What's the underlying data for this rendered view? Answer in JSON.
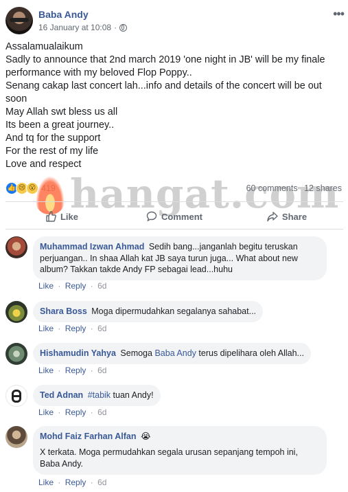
{
  "post": {
    "author": "Baba Andy",
    "timestamp": "16 January at 10:08",
    "separator": "·",
    "more_icon": "•••",
    "lines": [
      "Assalamualaikum",
      "Sadly to announce that 2nd march 2019 'one night in JB' will be my finale",
      "performance with my beloved Flop Poppy..",
      "Senang cakap last concert lah...info and details of the concert will be out",
      "soon",
      "May Allah swt bless us all",
      "Its been a great journey..",
      "And tq for the support",
      "For the rest of my life",
      "Love and respect"
    ]
  },
  "reactions": {
    "icons": [
      "like-icon",
      "sad-icon",
      "wow-icon"
    ],
    "count": "419",
    "comments": "60 comments",
    "shares": "12 shares"
  },
  "watermark": {
    "text": "hangat.com"
  },
  "actions": {
    "like": "Like",
    "comment": "Comment",
    "share": "Share"
  },
  "comment_actions": {
    "like": "Like",
    "reply": "Reply",
    "sep": "·"
  },
  "comments": [
    {
      "name": "Muhammad Izwan Ahmad",
      "lines": [
        "Sedih bang...janganlah begitu teruskan",
        "perjuangan.. In shaa Allah kat JB saya turun juga... What about new",
        "album? Takkan takde Andy FP sebagai lead...huhu"
      ],
      "time": "6d"
    },
    {
      "name": "Shara Boss",
      "text": "Moga dipermudahkan segalanya sahabat...",
      "time": "6d"
    },
    {
      "name": "Hishamudin Yahya",
      "text_before": "Semoga",
      "link": "Baba Andy",
      "text_after": "terus dipelihara oleh Allah...",
      "time": "6d"
    },
    {
      "name": "Ted Adnan",
      "hashtag": "#tabik",
      "text_after": "tuan Andy!",
      "time": "6d"
    },
    {
      "name": "Mohd Faiz Farhan Alfan",
      "emoji": "😭",
      "lines": [
        "X terkata. Moga permudahkan segala urusan sepanjang tempoh ini,",
        "Baba Andy."
      ],
      "time": "6d"
    }
  ],
  "colors": {
    "name_link": "#385898",
    "bubble_bg": "#f2f3f5",
    "meta_text": "#606770",
    "like_blue": "#1877f2"
  }
}
